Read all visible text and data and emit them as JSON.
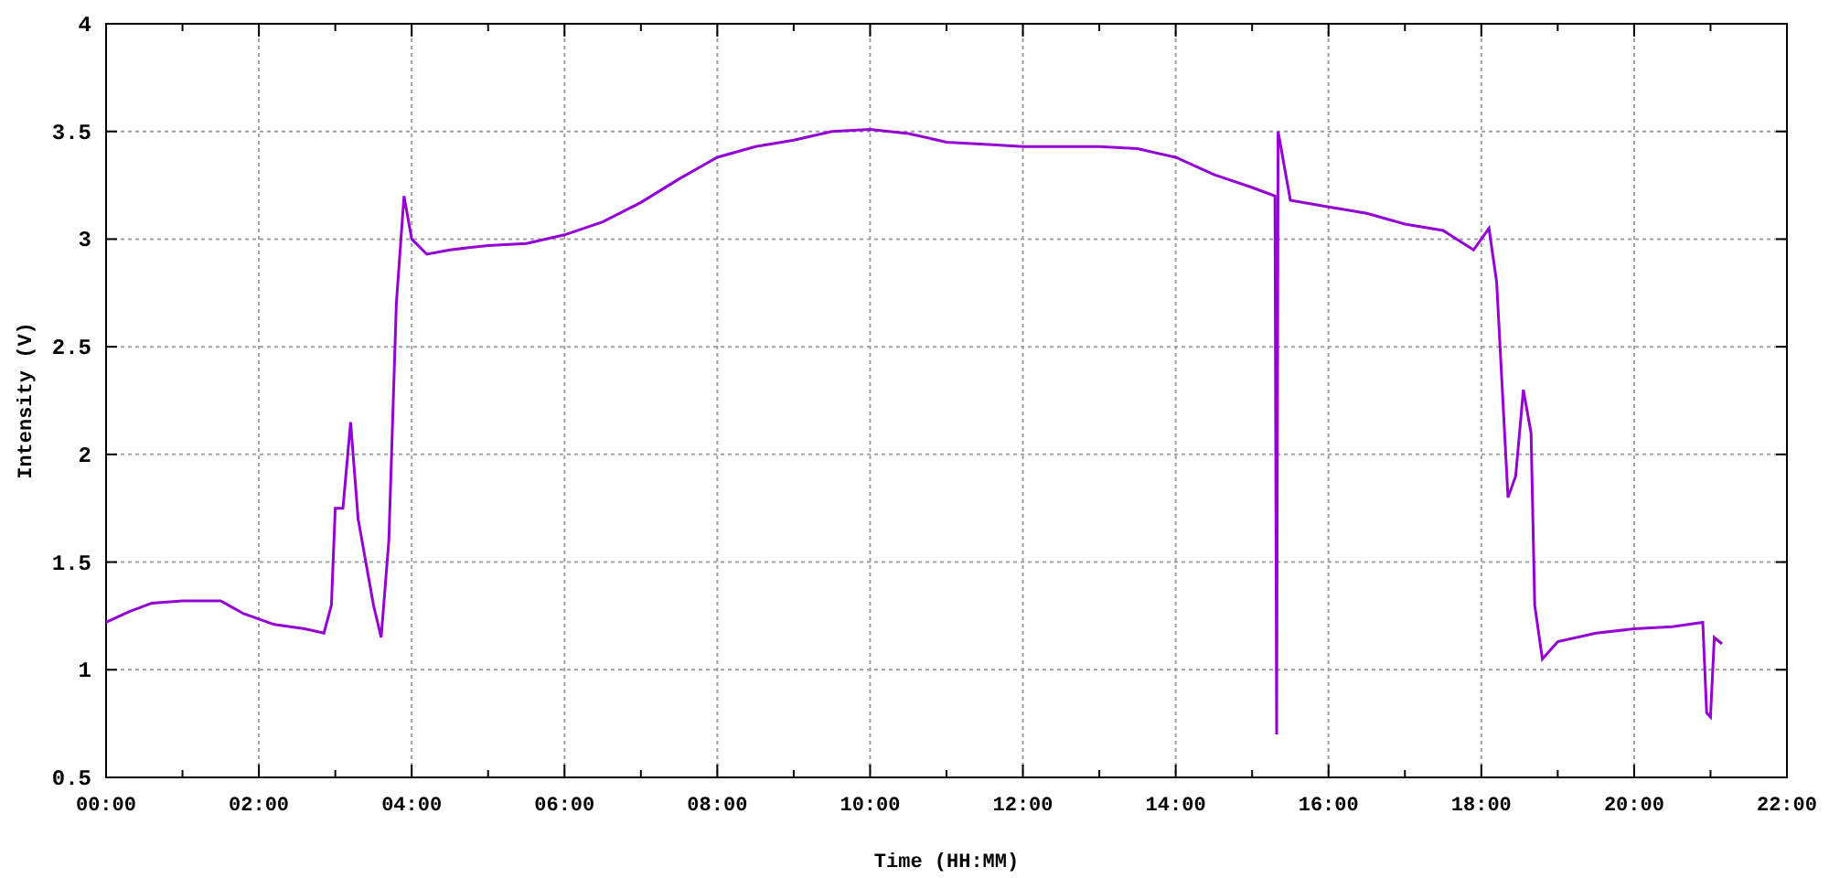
{
  "chart_data": {
    "type": "line",
    "grid": true,
    "xlabel": "Time (HH:MM)",
    "ylabel": "Intensity (V)",
    "xlim": [
      0,
      22
    ],
    "ylim": [
      0.5,
      4
    ],
    "xticks": [
      {
        "value": 0,
        "label": "00:00"
      },
      {
        "value": 2,
        "label": "02:00"
      },
      {
        "value": 4,
        "label": "04:00"
      },
      {
        "value": 6,
        "label": "06:00"
      },
      {
        "value": 8,
        "label": "08:00"
      },
      {
        "value": 10,
        "label": "10:00"
      },
      {
        "value": 12,
        "label": "12:00"
      },
      {
        "value": 14,
        "label": "14:00"
      },
      {
        "value": 16,
        "label": "16:00"
      },
      {
        "value": 18,
        "label": "18:00"
      },
      {
        "value": 20,
        "label": "20:00"
      },
      {
        "value": 22,
        "label": "22:00"
      }
    ],
    "yticks": [
      {
        "value": 0.5,
        "label": "0.5"
      },
      {
        "value": 1,
        "label": "1"
      },
      {
        "value": 1.5,
        "label": "1.5"
      },
      {
        "value": 2,
        "label": "2"
      },
      {
        "value": 2.5,
        "label": "2.5"
      },
      {
        "value": 3,
        "label": "3"
      },
      {
        "value": 3.5,
        "label": "3.5"
      },
      {
        "value": 4,
        "label": "4"
      }
    ],
    "x": [
      0,
      0.3,
      0.6,
      1,
      1.5,
      1.8,
      2.2,
      2.6,
      2.85,
      2.95,
      3.0,
      3.1,
      3.2,
      3.3,
      3.5,
      3.6,
      3.7,
      3.8,
      3.9,
      4.0,
      4.2,
      4.5,
      5,
      5.5,
      6,
      6.5,
      7,
      7.5,
      8,
      8.5,
      9,
      9.5,
      10,
      10.5,
      11,
      11.5,
      12,
      12.5,
      13,
      13.5,
      14,
      14.5,
      15,
      15.3,
      15.32,
      15.34,
      15.5,
      16,
      16.5,
      17,
      17.5,
      17.9,
      18.1,
      18.2,
      18.35,
      18.45,
      18.55,
      18.65,
      18.7,
      18.8,
      19,
      19.5,
      20,
      20.5,
      20.9,
      20.95,
      21.0,
      21.05,
      21.15
    ],
    "series": [
      {
        "color": "#9400d3",
        "values": [
          1.22,
          1.27,
          1.31,
          1.32,
          1.32,
          1.26,
          1.21,
          1.19,
          1.17,
          1.3,
          1.75,
          1.75,
          2.15,
          1.7,
          1.3,
          1.15,
          1.6,
          2.7,
          3.2,
          3.0,
          2.93,
          2.95,
          2.97,
          2.98,
          3.02,
          3.08,
          3.17,
          3.28,
          3.38,
          3.43,
          3.46,
          3.5,
          3.51,
          3.49,
          3.45,
          3.44,
          3.43,
          3.43,
          3.43,
          3.42,
          3.38,
          3.3,
          3.24,
          3.2,
          0.7,
          3.5,
          3.18,
          3.15,
          3.12,
          3.07,
          3.04,
          2.95,
          3.05,
          2.8,
          1.8,
          1.9,
          2.3,
          2.1,
          1.3,
          1.05,
          1.13,
          1.17,
          1.19,
          1.2,
          1.22,
          0.8,
          0.78,
          1.15,
          1.12
        ]
      }
    ]
  }
}
